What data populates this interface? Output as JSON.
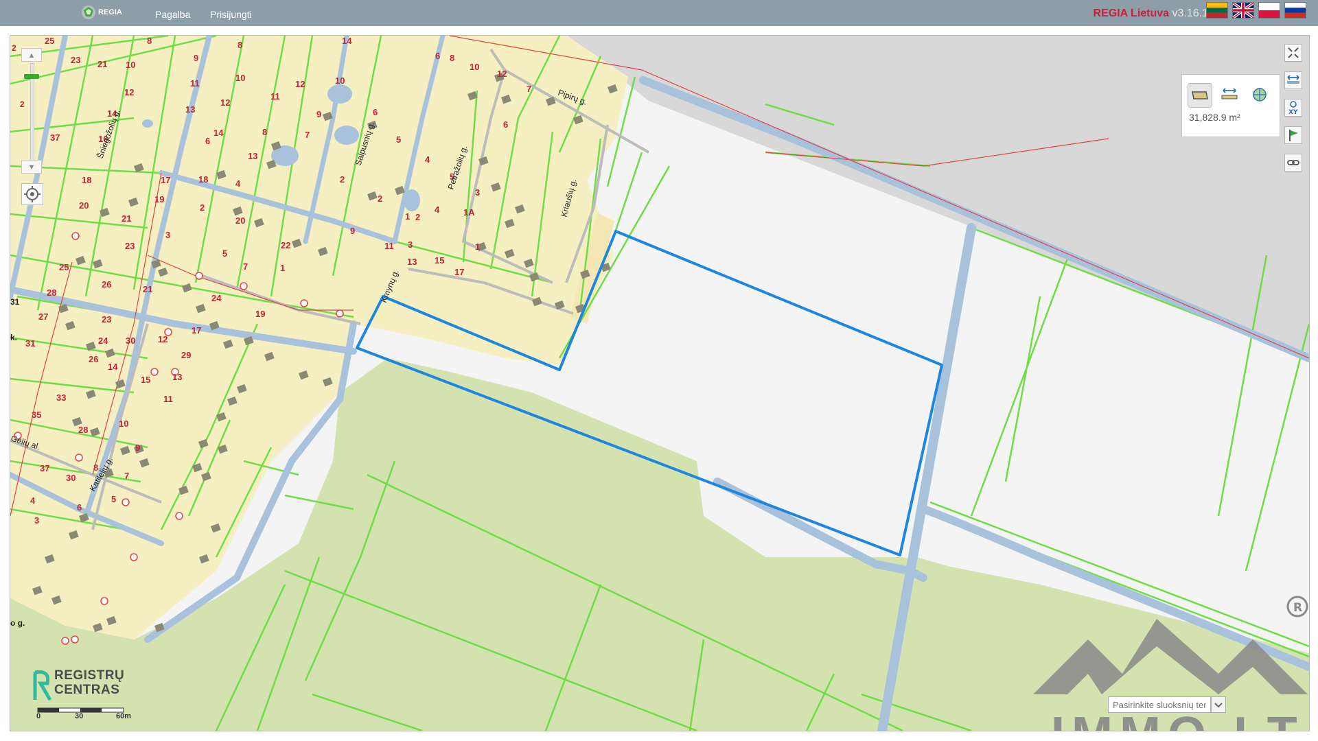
{
  "header": {
    "logo_text": "REGIA",
    "nav": [
      "Pagalba",
      "Prisijungti"
    ],
    "brand_name": "REGIA Lietuva",
    "brand_version": "v3.16.1",
    "flags": [
      "lt-flag-icon",
      "gb-flag-icon",
      "pl-flag-icon",
      "ru-flag-icon"
    ]
  },
  "map": {
    "streets": [
      "Pipirų g.",
      "Kriaušių g.",
      "Petražolių g.",
      "Salpusnių g.",
      "Kmynų g.",
      "Gėlių al.",
      "Katilelių g.",
      "Šniegožolių g."
    ],
    "edge_labels": [
      "2",
      "2",
      "31",
      "k.",
      "o g."
    ],
    "parcel_numbers": [
      "25",
      "23",
      "21",
      "10",
      "12",
      "13",
      "14",
      "16",
      "37",
      "8",
      "9",
      "11",
      "8",
      "10",
      "12",
      "14",
      "6",
      "13",
      "14",
      "12",
      "11",
      "10",
      "9",
      "8",
      "7",
      "6",
      "5",
      "4",
      "6",
      "8",
      "10",
      "12",
      "7",
      "6",
      "5",
      "4",
      "3",
      "1A",
      "1",
      "2",
      "1",
      "2",
      "3",
      "15",
      "17",
      "13",
      "11",
      "9",
      "18",
      "17",
      "18",
      "19",
      "20",
      "21",
      "23",
      "4",
      "2",
      "2",
      "20",
      "3",
      "5",
      "7",
      "1",
      "22",
      "21",
      "24",
      "25",
      "26",
      "28",
      "27",
      "23",
      "19",
      "17",
      "29",
      "24",
      "30",
      "31",
      "26",
      "14",
      "12",
      "15",
      "13",
      "11",
      "33",
      "35",
      "28",
      "10",
      "9",
      "8",
      "7",
      "5",
      "6",
      "4",
      "3",
      "30",
      "37"
    ],
    "area_value": "31,828.9 m²",
    "measure_tools": [
      "area-measure-icon",
      "distance-measure-icon",
      "coordinate-measure-icon"
    ],
    "right_tools": [
      "fullscreen-icon",
      "measure-distance-icon",
      "xy-coordinates-icon",
      "flag-icon",
      "link-icon"
    ],
    "scale_labels": [
      "0",
      "30",
      "60m"
    ],
    "watermark_logo": "REGISTRŲ CENTRAS",
    "watermark_immo": "IMMO.LT",
    "theme_placeholder": "Pasirinkite sluoksnių temą"
  },
  "colors": {
    "header_bg": "#8e9ea8",
    "parcel_fill": "#f6efc2",
    "parcel_line": "#6fdd45",
    "forest_fill": "#d4e2b0",
    "road_fill": "#a8c2dc",
    "highlight": "#1f86e0",
    "number_color": "#c8203a"
  }
}
